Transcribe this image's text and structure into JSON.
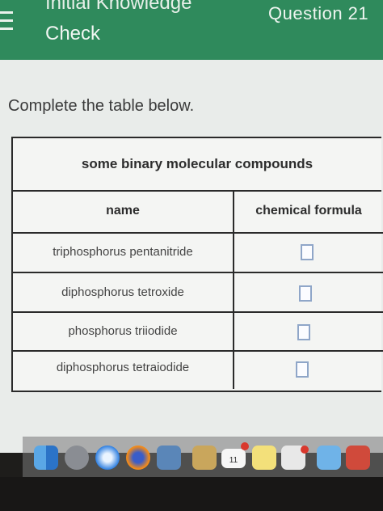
{
  "header": {
    "title_line1": "Initial Knowledge",
    "title_line2": "Check",
    "question_label": "Question 21"
  },
  "instruction": "Complete the table below.",
  "table": {
    "caption": "some binary molecular compounds",
    "columns": [
      "name",
      "chemical formula"
    ],
    "rows": [
      {
        "name": "triphosphorus pentanitride",
        "formula": ""
      },
      {
        "name": "diphosphorus tetroxide",
        "formula": ""
      },
      {
        "name": "phosphorus triiodide",
        "formula": ""
      },
      {
        "name": "diphosphorus tetraiodide",
        "formula": ""
      }
    ]
  },
  "dock": {
    "icons": [
      "finder-icon",
      "launchpad-icon",
      "safari-icon",
      "firefox-icon",
      "preview-icon",
      "notes-app-icon",
      "calendar-icon",
      "stickies-icon",
      "reminders-icon",
      "messages-icon",
      "photo-icon",
      "photo-booth-icon"
    ],
    "calendar_day": "11"
  },
  "colors": {
    "header_green": "#2f8a5c",
    "answer_box_border": "#8fa6c8"
  }
}
